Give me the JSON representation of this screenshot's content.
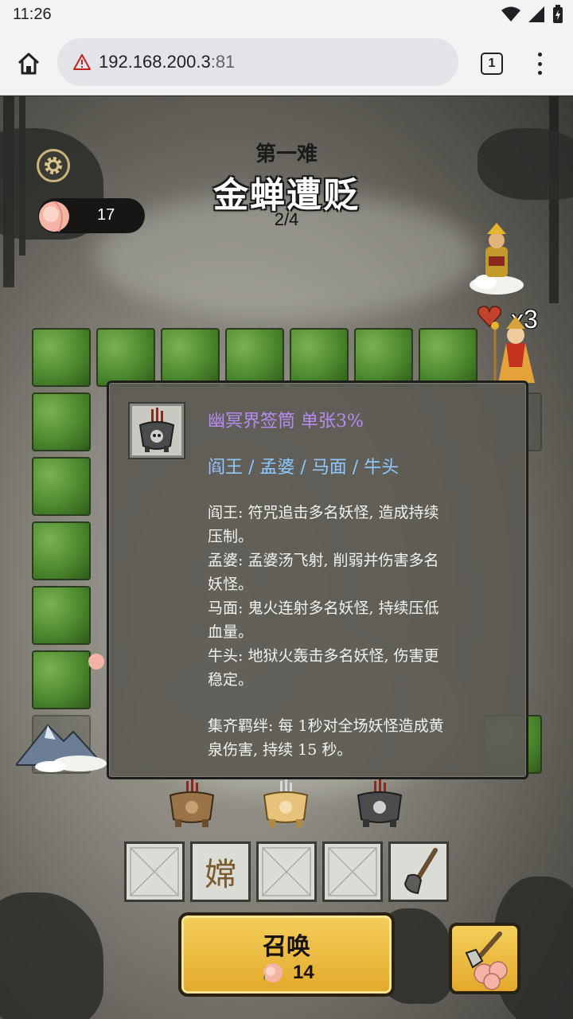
{
  "status_bar": {
    "time": "11:26"
  },
  "browser": {
    "url_host": "192.168.200.3",
    "url_port": ":81",
    "tab_count": "1"
  },
  "stage": {
    "subtitle": "第一难",
    "title": "金蝉遭贬",
    "progress": "2/4"
  },
  "resources": {
    "peach_count": "17",
    "lives": "x3"
  },
  "tooltip": {
    "item_name": "幽冥界签筒 单张3%",
    "heroes": "阎王 / 孟婆 / 马面 / 牛头",
    "lines": [
      "阎王: 符咒追击多名妖怪, 造成持续",
      "压制。",
      "孟婆: 孟婆汤飞射, 削弱并伤害多名",
      "妖怪。",
      "马面: 鬼火连射多名妖怪, 持续压低",
      "血量。",
      "牛头: 地狱火轰击多名妖怪, 伤害更",
      "稳定。",
      "集齐羁绊: 每 1秒对全场妖怪造成黄",
      "泉伤害, 持续 15 秒。"
    ]
  },
  "inventory": {
    "slot2_char": "嫦"
  },
  "summon": {
    "label": "召唤",
    "cost": "14"
  },
  "colors": {
    "gold": "#e3a92b",
    "purple_text": "#b78cf2",
    "blue_text": "#8ec9ff",
    "bush_green": "#4d8a2e"
  }
}
